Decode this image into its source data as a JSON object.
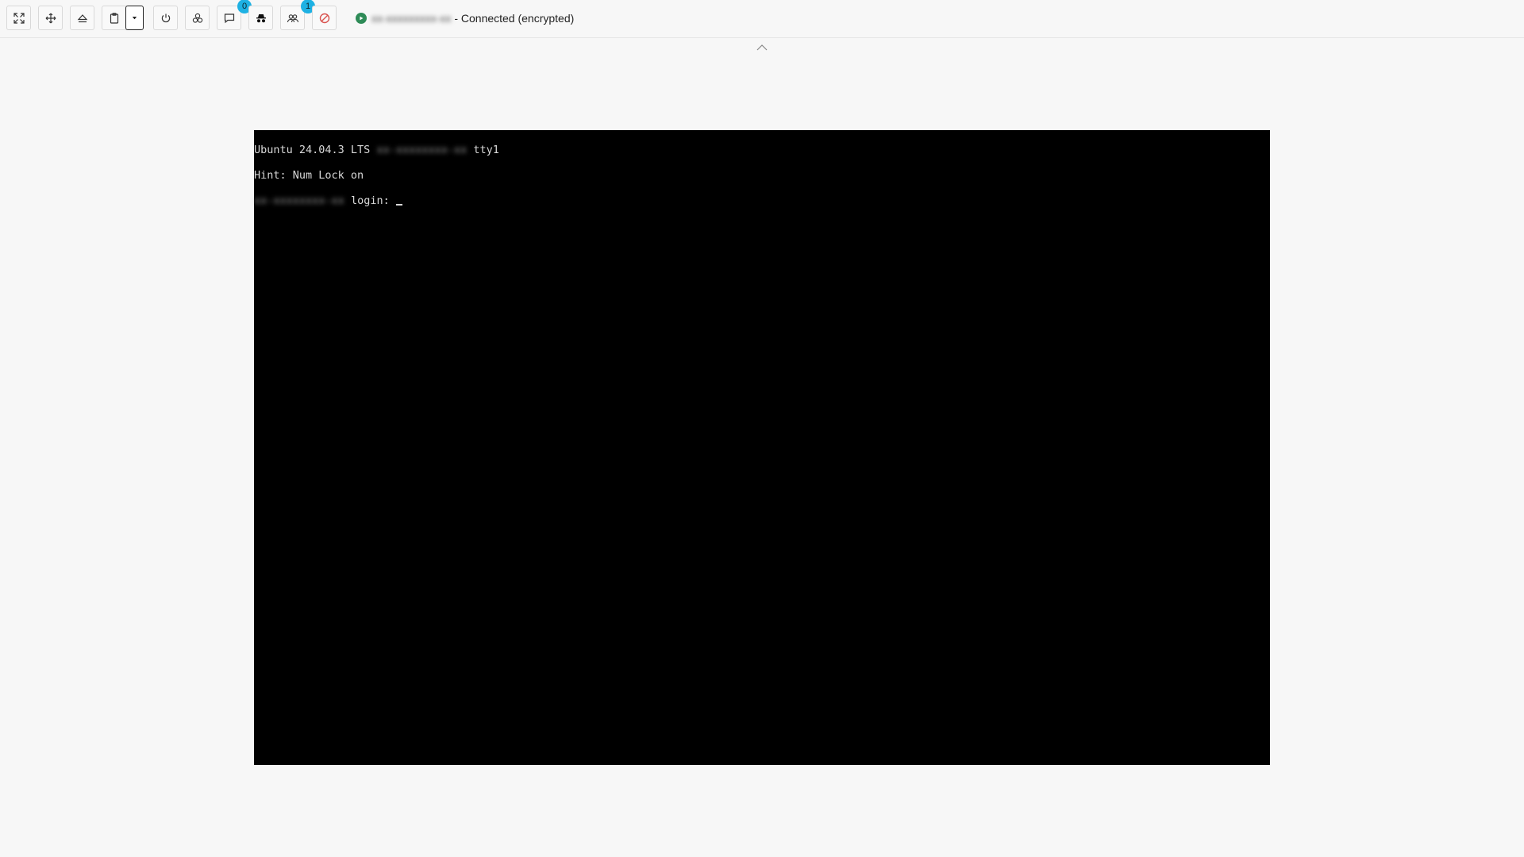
{
  "toolbar": {
    "buttons": [
      {
        "name": "fullscreen-button",
        "icon": "fullscreen-icon"
      },
      {
        "name": "move-button",
        "icon": "move-arrows-icon"
      },
      {
        "name": "eject-button",
        "icon": "eject-icon"
      },
      {
        "name": "clipboard-button",
        "icon": "clipboard-icon"
      },
      {
        "name": "power-button",
        "icon": "power-icon"
      },
      {
        "name": "settings-button",
        "icon": "cluster-gear-icon"
      },
      {
        "name": "chat-button",
        "icon": "chat-icon",
        "badge": "0"
      },
      {
        "name": "incognito-button",
        "icon": "spy-icon"
      },
      {
        "name": "users-button",
        "icon": "users-icon",
        "badge": "1"
      },
      {
        "name": "disconnect-button",
        "icon": "block-icon"
      }
    ],
    "accent_badge_color": "#1eb1e3",
    "disconnect_color": "#d9534f"
  },
  "status": {
    "host": "xx-xxxxxxxxx-xx",
    "text": "- Connected (encrypted)",
    "indicator_color": "#2e8b57"
  },
  "console": {
    "line1_prefix": "Ubuntu 24.04.3 LTS",
    "line1_host": "xx-xxxxxxxx-xx",
    "line1_suffix": "tty1",
    "line2": "Hint: Num Lock on",
    "line3_host": "xx-xxxxxxxx-xx",
    "line3_suffix": "login:"
  }
}
